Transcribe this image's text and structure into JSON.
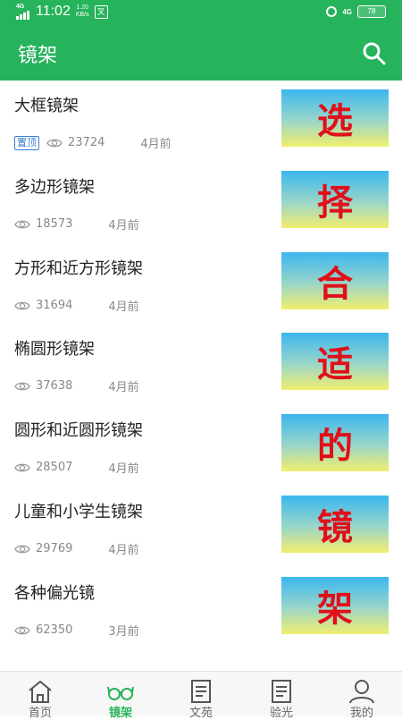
{
  "status_bar": {
    "network": "4G",
    "time": "11:02",
    "speed_value": "1.20",
    "speed_unit": "KB/s",
    "app_badge": "叉",
    "network_right": "4G",
    "battery": "78"
  },
  "app_bar": {
    "title": "镜架"
  },
  "list": [
    {
      "title": "大框镜架",
      "pinned_label": "置顶",
      "views": "23724",
      "time": "4月前",
      "thumb_char": "选"
    },
    {
      "title": "多边形镜架",
      "views": "18573",
      "time": "4月前",
      "thumb_char": "择"
    },
    {
      "title": "方形和近方形镜架",
      "views": "31694",
      "time": "4月前",
      "thumb_char": "合"
    },
    {
      "title": "椭圆形镜架",
      "views": "37638",
      "time": "4月前",
      "thumb_char": "适"
    },
    {
      "title": "圆形和近圆形镜架",
      "views": "28507",
      "time": "4月前",
      "thumb_char": "的"
    },
    {
      "title": "儿童和小学生镜架",
      "views": "29769",
      "time": "4月前",
      "thumb_char": "镜"
    },
    {
      "title": "各种偏光镜",
      "views": "62350",
      "time": "3月前",
      "thumb_char": "架"
    }
  ],
  "bottom_nav": [
    {
      "label": "首页",
      "icon": "home-icon"
    },
    {
      "label": "镜架",
      "icon": "glasses-icon",
      "active": true
    },
    {
      "label": "文苑",
      "icon": "document-icon"
    },
    {
      "label": "验光",
      "icon": "document-icon"
    },
    {
      "label": "我的",
      "icon": "user-icon"
    }
  ],
  "colors": {
    "primary": "#25b35b",
    "thumb_text": "#e0101a",
    "pin_badge": "#3a7bd5"
  }
}
